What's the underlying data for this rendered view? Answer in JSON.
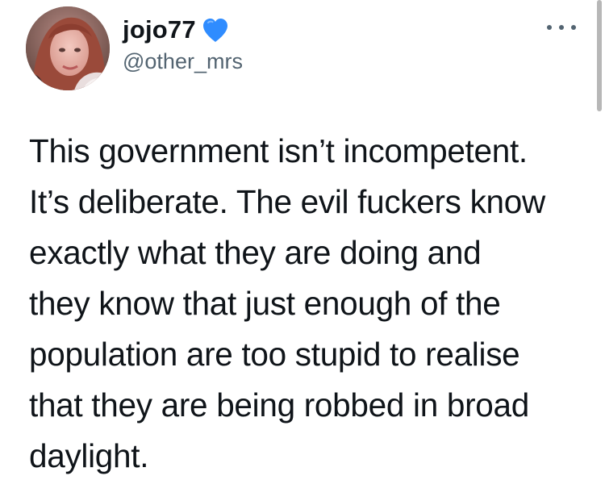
{
  "tweet": {
    "author": {
      "display_name": "jojo77",
      "handle": "@other_mrs",
      "badge_icon": "blue-heart-icon",
      "badge_color": "#2f8cff"
    },
    "more_icon": "more-options-icon",
    "text_lines": [
      "This government isn’t incompetent.",
      "It’s deliberate. The evil fuckers know",
      "exactly what they are doing and",
      "they know that just enough of the",
      "population are too stupid to realise",
      "that they are being robbed in broad",
      "daylight."
    ]
  }
}
